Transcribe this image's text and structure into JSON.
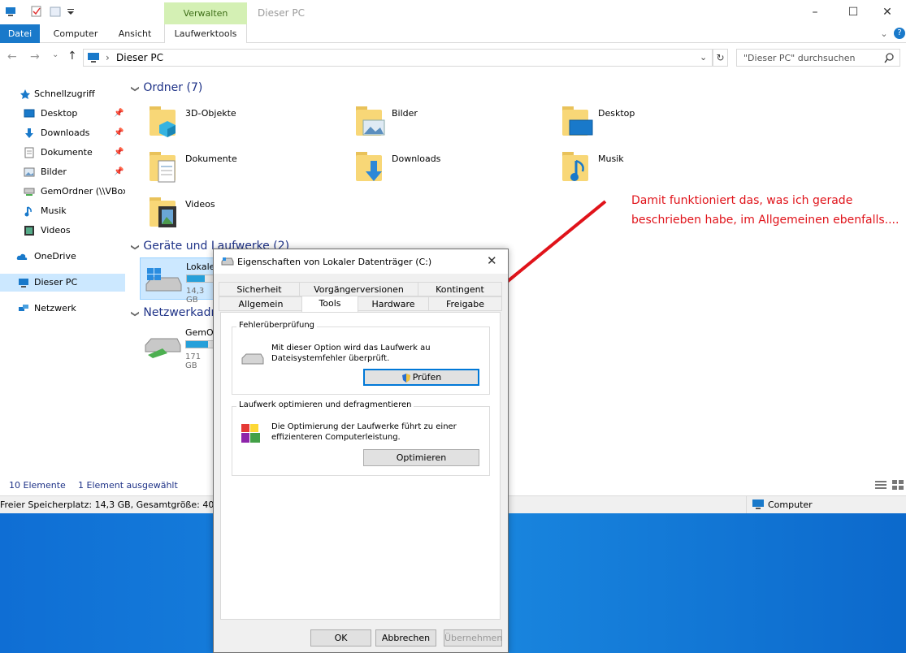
{
  "window": {
    "title": "Dieser PC",
    "contextual_tab": "Verwalten",
    "minimize": "–",
    "maximize": "☐",
    "close": "✕"
  },
  "ribbon": {
    "tabs": [
      "Datei",
      "Computer",
      "Ansicht",
      "Laufwerktools"
    ],
    "expand": "⌄",
    "help": "?"
  },
  "address": {
    "path_sep": "›",
    "path": "Dieser PC",
    "search_placeholder": "\"Dieser PC\" durchsuchen",
    "dropdown": "⌄",
    "refresh": "↻",
    "back": "←",
    "forward": "→",
    "recent": "⌄",
    "up": "↑"
  },
  "nav": {
    "items": [
      {
        "label": "Schnellzugriff"
      },
      {
        "label": "Desktop"
      },
      {
        "label": "Downloads"
      },
      {
        "label": "Dokumente"
      },
      {
        "label": "Bilder"
      },
      {
        "label": "GemOrdner (\\\\VBox"
      },
      {
        "label": "Musik"
      },
      {
        "label": "Videos"
      },
      {
        "label": "OneDrive"
      },
      {
        "label": "Dieser PC"
      },
      {
        "label": "Netzwerk"
      }
    ],
    "pin": "📌"
  },
  "content": {
    "chev": "❯",
    "groups": {
      "ordner": "Ordner (7)",
      "geraete": "Geräte und Laufwerke (2)",
      "netzwerk": "Netzwerkadr"
    },
    "folders": [
      "3D-Objekte",
      "Bilder",
      "Desktop",
      "Dokumente",
      "Downloads",
      "Musik",
      "Videos"
    ],
    "drive_c": {
      "label": "Lokale",
      "size": "14,3 GB",
      "fill_fraction": 0.65
    },
    "drive_net": {
      "label": "GemO",
      "size": "171 GB",
      "fill_fraction": 0.8
    }
  },
  "status": {
    "count": "10 Elemente",
    "selection": "1 Element ausgewählt",
    "free_space": "Freier Speicherplatz: 14,3 GB, Gesamtgröße: 40,7 G",
    "location": "Computer"
  },
  "dialog": {
    "title": "Eigenschaften von Lokaler Datenträger (C:)",
    "close": "✕",
    "tabs_top": [
      "Sicherheit",
      "Vorgängerversionen",
      "Kontingent"
    ],
    "tabs_bottom": [
      "Allgemein",
      "Tools",
      "Hardware",
      "Freigabe"
    ],
    "error_check": {
      "title": "Fehlerüberprüfung",
      "text1": "Mit dieser Option wird das Laufwerk au",
      "text2": "Dateisystemfehler überprüft.",
      "button": "Prüfen"
    },
    "optimize": {
      "title": "Laufwerk optimieren und defragmentieren",
      "text1": "Die Optimierung der Laufwerke führt zu einer",
      "text2": "effizienteren Computerleistung.",
      "button": "Optimieren"
    },
    "buttons": {
      "ok": "OK",
      "cancel": "Abbrechen",
      "apply": "Übernehmen"
    }
  },
  "annotation": {
    "text": "Damit funktioniert das, was ich gerade beschrieben habe, im Allgemeinen ebenfalls....",
    "color": "#e0131a"
  },
  "colors": {
    "accent": "#1979ca",
    "drive_bar": "#26a0da",
    "selected_bg": "#cce8ff",
    "contextual": "#d4f0b4"
  }
}
